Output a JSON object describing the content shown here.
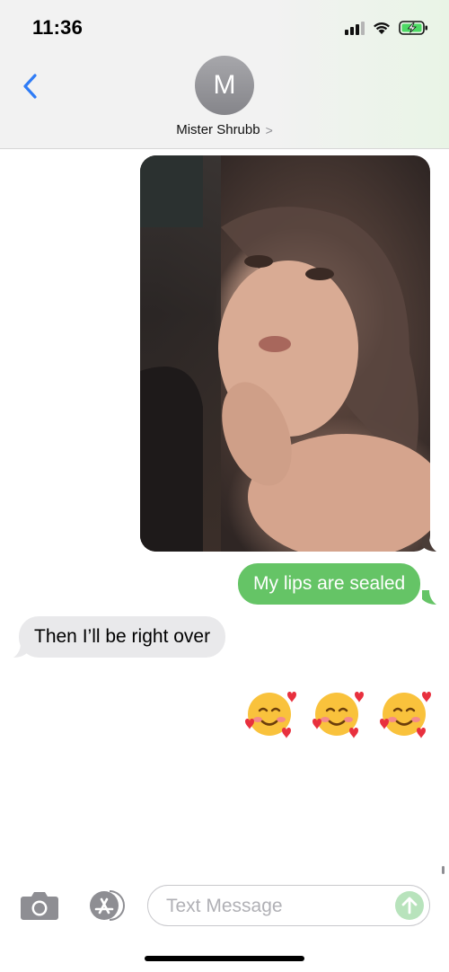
{
  "status_bar": {
    "time": "11:36",
    "icons": [
      "cellular-signal-icon",
      "wifi-icon",
      "battery-charging-icon"
    ]
  },
  "header": {
    "back_icon": "chevron-left-icon",
    "avatar_initial": "M",
    "contact_name": "Mister Shrubb",
    "contact_chevron": ">"
  },
  "messages": [
    {
      "type": "image",
      "direction": "sent",
      "description_icon": "photo-attachment"
    },
    {
      "type": "text",
      "direction": "sent",
      "text": "My lips are sealed"
    },
    {
      "type": "text",
      "direction": "received",
      "text": "Then I’ll be right over"
    },
    {
      "type": "emoji",
      "direction": "sent",
      "emoji": [
        "smiling-face-with-hearts-icon",
        "smiling-face-with-hearts-icon",
        "smiling-face-with-hearts-icon"
      ]
    }
  ],
  "input_bar": {
    "camera_icon": "camera-icon",
    "apps_icon": "app-store-icon",
    "placeholder": "Text Message",
    "value": "",
    "send_icon": "arrow-up-icon"
  },
  "colors": {
    "sent_bubble": "#65c466",
    "received_bubble": "#e9e9eb",
    "accent_blue": "#2f7cf6",
    "send_button_disabled": "#b8e3bc"
  }
}
